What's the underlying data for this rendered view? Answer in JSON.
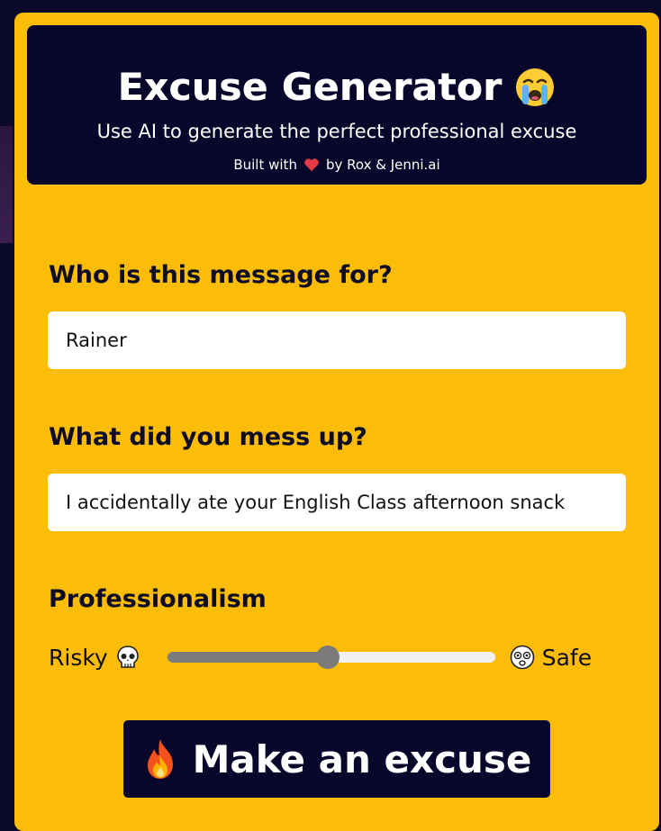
{
  "app": {
    "title": "Excuse Generator",
    "subtitle": "Use AI to generate the perfect professional excuse",
    "built_with_prefix": "Built with",
    "built_with_suffix": "by Rox & Jenni.ai"
  },
  "form": {
    "recipient_label": "Who is this message for?",
    "recipient_value": "Rainer",
    "mistake_label": "What did you mess up?",
    "mistake_value": "I accidentally ate your English Class afternoon snack",
    "professionalism_label": "Professionalism",
    "risky_label": "Risky",
    "safe_label": "Safe",
    "professionalism_level": 0.49
  },
  "actions": {
    "make_excuse_label": "Make an excuse"
  },
  "icons": {
    "title_emoji": "crying-face-icon",
    "heart": "heart-icon",
    "risky": "skull-icon",
    "safe": "dizzy-face-icon",
    "button": "fire-icon"
  },
  "colors": {
    "card_bg": "#fbbd08",
    "header_bg": "#08072b",
    "page_bg": "#0b0a2a",
    "heart": "#e63946",
    "slider_fill": "#7a7a7a"
  }
}
